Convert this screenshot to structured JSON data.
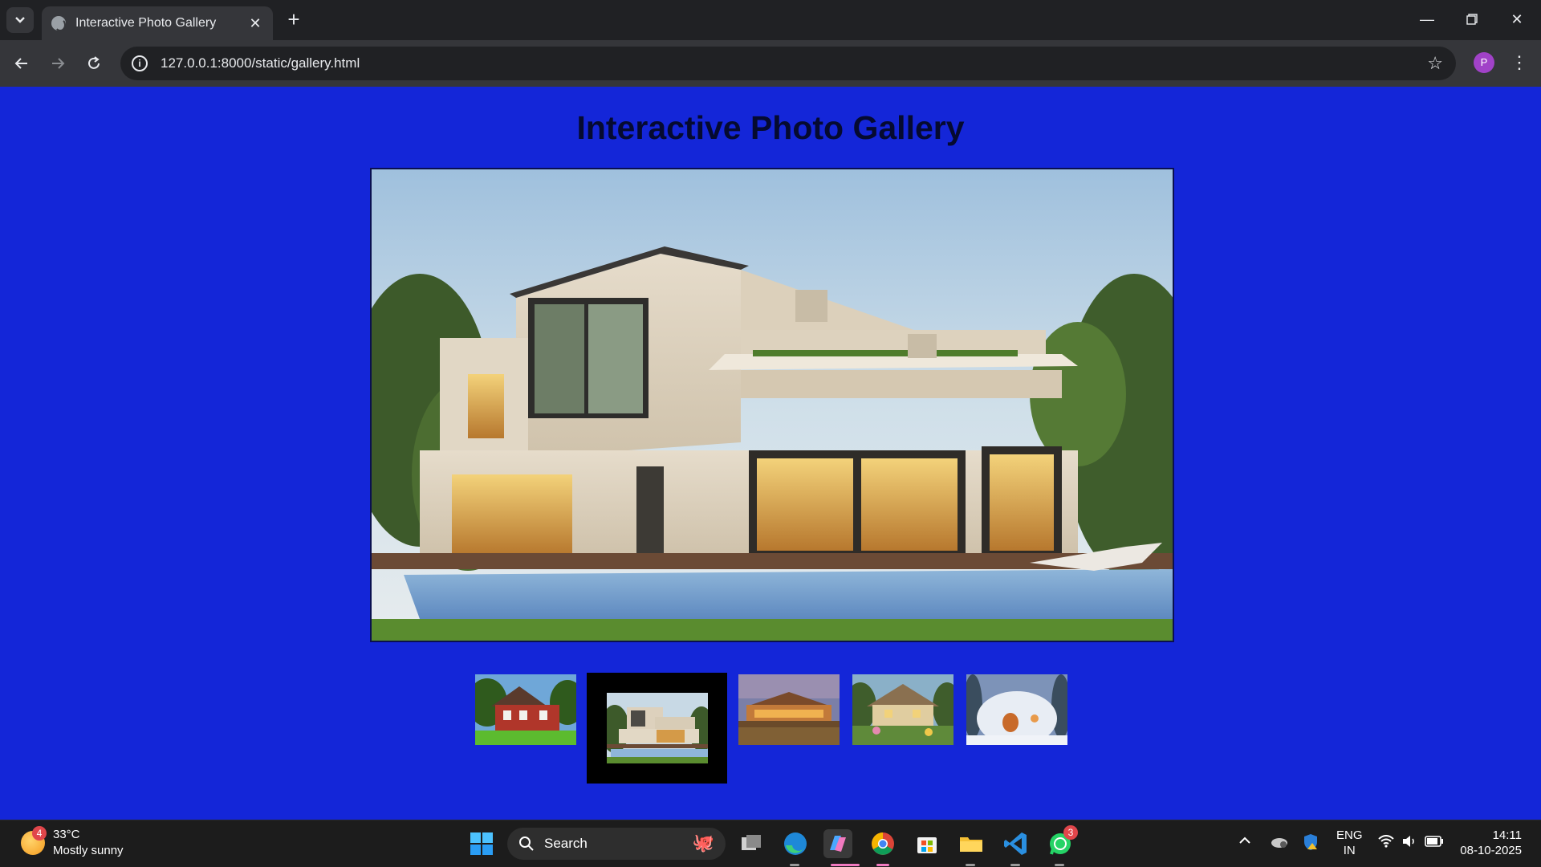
{
  "browser": {
    "tab_title": "Interactive Photo Gallery",
    "url": "127.0.0.1:8000/static/gallery.html",
    "profile_initial": "P"
  },
  "page": {
    "heading": "Interactive Photo Gallery",
    "background_color": "#1426d8",
    "main_image": "modern-villa-with-pool",
    "thumbnails": [
      {
        "name": "red-brick-house",
        "active": false
      },
      {
        "name": "modern-villa-with-pool",
        "active": true
      },
      {
        "name": "mansion-by-water-at-dusk",
        "active": false
      },
      {
        "name": "thatched-cottage",
        "active": false
      },
      {
        "name": "snowy-dome-house",
        "active": false
      }
    ]
  },
  "taskbar": {
    "weather_temp": "33°C",
    "weather_desc": "Mostly sunny",
    "weather_badge": "4",
    "search_placeholder": "Search",
    "whatsapp_badge": "3",
    "language_line1": "ENG",
    "language_line2": "IN",
    "time": "14:11",
    "date": "08-10-2025"
  }
}
